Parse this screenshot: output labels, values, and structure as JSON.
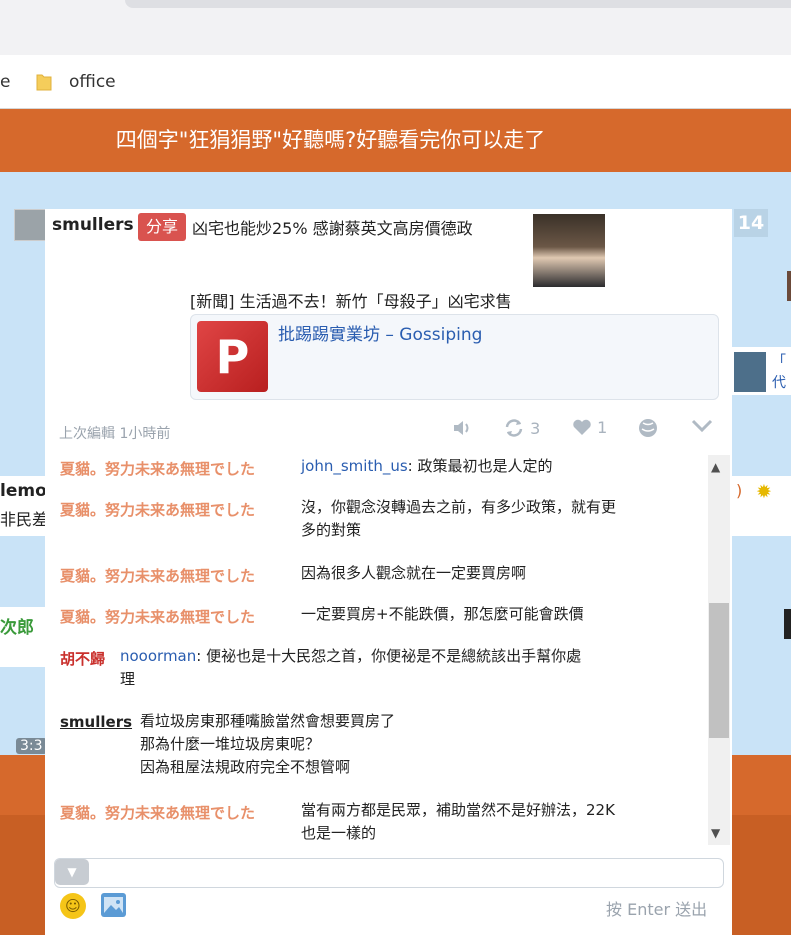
{
  "bookmarks": {
    "left_fragment": "e",
    "office": "office"
  },
  "page": {
    "banner_title": "四個字\"狂狷狷野\"好聽嗎?好聽看完你可以走了"
  },
  "background": {
    "left_text1": "lemo",
    "left_text2": "非民差",
    "left_text3": "次郎",
    "left_time": "3:3",
    "badge": "14",
    "right_text1": "「",
    "right_text2": "代"
  },
  "post": {
    "author": "smullers",
    "share_label": "分享",
    "text": "凶宅也能炒25% 感謝蔡英文高房價德政",
    "news": "[新聞] 生活過不去！新竹「母殺子」凶宅求售",
    "link_title": "批踢踢實業坊 – Gossiping",
    "edit_info": "上次編輯 1小時前",
    "share_count": "3",
    "like_count": "1"
  },
  "comments": [
    {
      "author": "夏貓。努力未来あ無理でした",
      "mention": "john_smith_us",
      "text": ": 政策最初也是人定的"
    },
    {
      "author": "夏貓。努力未来あ無理でした",
      "line1": "沒，你觀念沒轉過去之前，有多少政策，就有更",
      "line2": "多的對策"
    },
    {
      "author": "夏貓。努力未来あ無理でした",
      "line1": "因為很多人觀念就在一定要買房啊"
    },
    {
      "author": "夏貓。努力未来あ無理でした",
      "line1": "一定要買房+不能跌價，那怎麼可能會跌價"
    },
    {
      "author": "胡不歸",
      "mention": "nooorman",
      "text": ": 便祕也是十大民怨之首，你便祕是不是總統該出手幫你處",
      "line2": "理"
    },
    {
      "author": "smullers",
      "line1": "看垃圾房東那種嘴臉當然會想要買房了",
      "line2": "那為什麼一堆垃圾房東呢？",
      "line3": "因為租屋法規政府完全不想管啊"
    },
    {
      "author": "夏貓。努力未来あ無理でした",
      "line1": "當有兩方都是民眾，補助當然不是好辦法，22K",
      "line2": "也是一樣的"
    }
  ],
  "composer": {
    "send_hint": "按 Enter 送出"
  }
}
